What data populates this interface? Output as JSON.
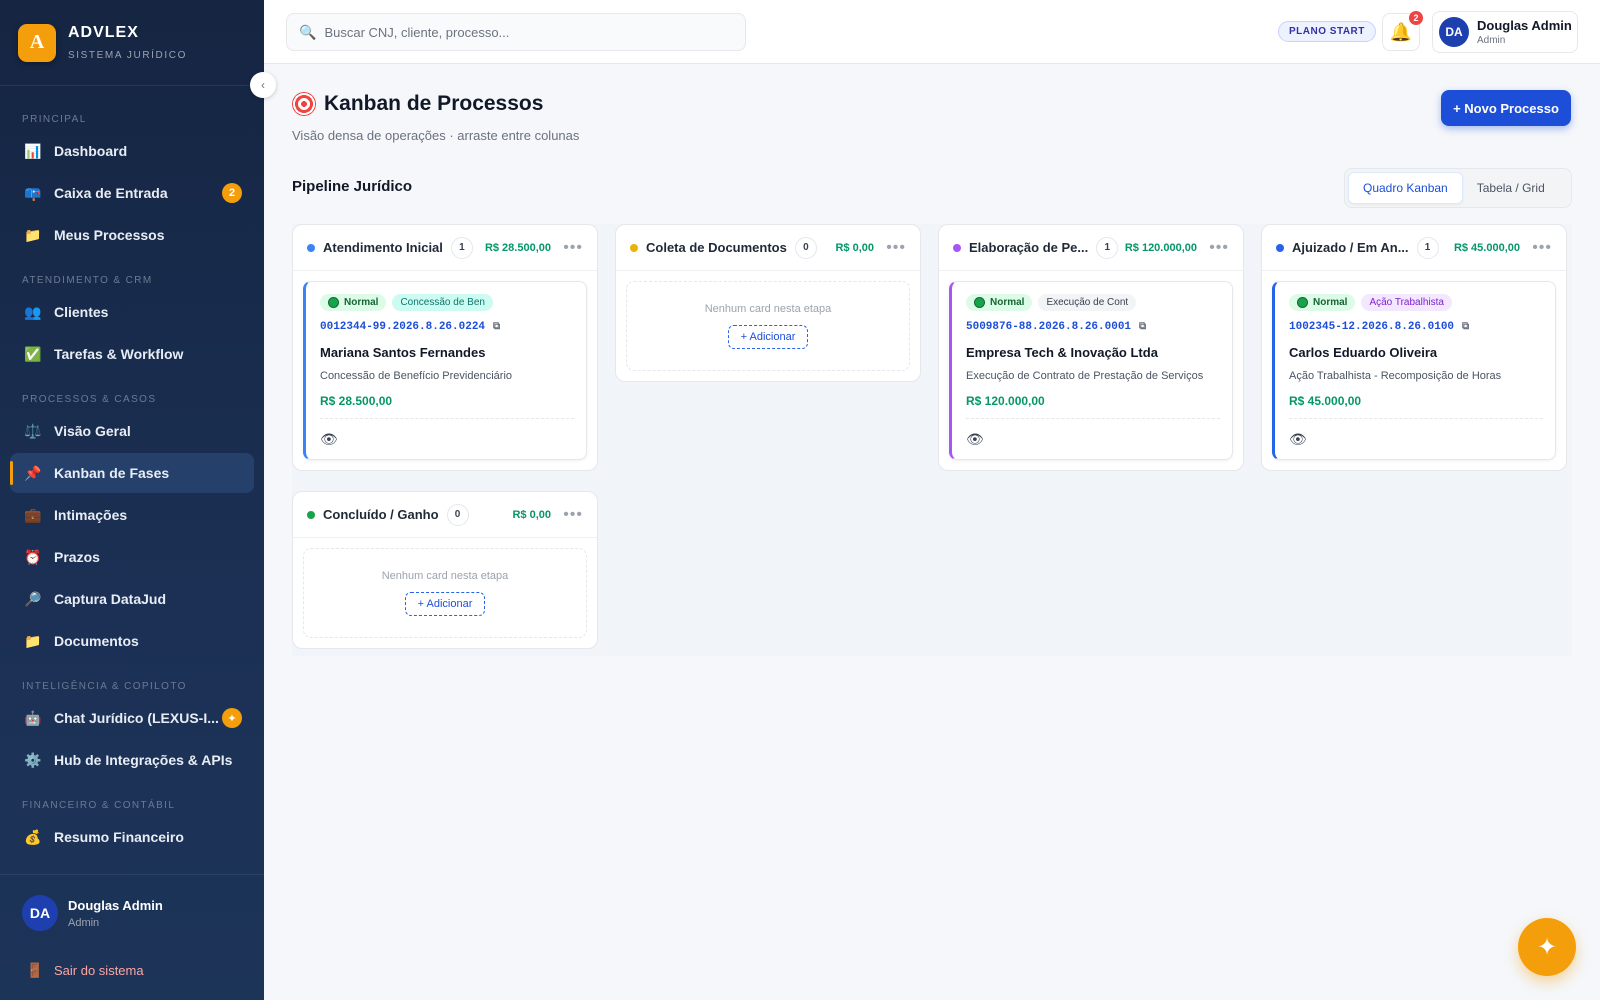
{
  "brand": {
    "logo_letter": "A",
    "name": "ADVLEX",
    "subtitle": "SISTEMA JURÍDICO"
  },
  "sidebar": {
    "sections": [
      {
        "label": "PRINCIPAL"
      },
      {
        "label": "ATENDIMENTO & CRM"
      },
      {
        "label": "PROCESSOS & CASOS"
      },
      {
        "label": "INTELIGÊNCIA & COPILOTO"
      },
      {
        "label": "FINANCEIRO & CONTÁBIL"
      }
    ],
    "items": [
      {
        "label": "Dashboard",
        "icon": "chart-icon"
      },
      {
        "label": "Caixa de Entrada",
        "icon": "mailbox-icon",
        "badge": "2"
      },
      {
        "label": "Meus Processos",
        "icon": "folder-icon"
      },
      {
        "label": "Clientes",
        "icon": "users-icon"
      },
      {
        "label": "Tarefas & Workflow",
        "icon": "check-icon"
      },
      {
        "label": "Visão Geral",
        "icon": "scales-icon"
      },
      {
        "label": "Kanban de Fases",
        "icon": "pin-icon",
        "active": true
      },
      {
        "label": "Intimações",
        "icon": "briefcase-icon"
      },
      {
        "label": "Prazos",
        "icon": "alarm-icon"
      },
      {
        "label": "Captura DataJud",
        "icon": "magnifier-icon"
      },
      {
        "label": "Documentos",
        "icon": "folder-icon"
      },
      {
        "label": "Chat Jurídico (LEXUS-I...",
        "icon": "robot-icon",
        "badge": "✦"
      },
      {
        "label": "Hub de Integrações & APIs",
        "icon": "gear-icon"
      },
      {
        "label": "Resumo Financeiro",
        "icon": "money-bag-icon"
      }
    ],
    "user": {
      "initials": "DA",
      "name": "Douglas Admin",
      "role": "Admin"
    },
    "logout_label": "Sair do sistema"
  },
  "header": {
    "search_placeholder": "Buscar CNJ, cliente, processo...",
    "plan": "PLANO START",
    "notifications": "2",
    "user": {
      "initials": "DA",
      "name": "Douglas Admin",
      "role": "Admin"
    }
  },
  "page": {
    "title": "Kanban de Processos",
    "subtitle": "Visão densa de operações · arraste entre colunas",
    "new_button": "+ Novo Processo",
    "pipeline_title": "Pipeline Jurídico",
    "views": [
      "Quadro Kanban",
      "Tabela / Grid"
    ],
    "active_view": "Quadro Kanban"
  },
  "colors": {
    "accent": "#1d4ed8",
    "brand": "#f59e0b",
    "success": "#059669"
  },
  "columns": [
    {
      "title": "Atendimento Inicial",
      "count": "1",
      "total": "R$ 28.500,00",
      "color": "#3b82f6",
      "cards": [
        {
          "priority": "Normal",
          "type": "Concessão de Ben",
          "type_bg": "#ccfbf1",
          "type_color": "#0f766e",
          "cnj": "0012344-99.2026.8.26.0224",
          "client": "Mariana Santos Fernandes",
          "description": "Concessão de Benefício Previdenciário",
          "value": "R$ 28.500,00",
          "accent": "#3b82f6"
        }
      ]
    },
    {
      "title": "Coleta de Documentos",
      "count": "0",
      "total": "R$ 0,00",
      "color": "#eab308",
      "cards": [],
      "empty_text": "Nenhum card nesta etapa",
      "add_label": "+ Adicionar"
    },
    {
      "title": "Elaboração de Pe...",
      "count": "1",
      "total": "R$ 120.000,00",
      "color": "#a855f7",
      "cards": [
        {
          "priority": "Normal",
          "type": "Execução de Cont",
          "type_bg": "#f3f4f6",
          "type_color": "#374151",
          "cnj": "5009876-88.2026.8.26.0001",
          "client": "Empresa Tech & Inovação Ltda",
          "description": "Execução de Contrato de Prestação de Serviços",
          "value": "R$ 120.000,00",
          "accent": "#a855f7"
        }
      ]
    },
    {
      "title": "Ajuizado / Em An...",
      "count": "1",
      "total": "R$ 45.000,00",
      "color": "#2563eb",
      "cards": [
        {
          "priority": "Normal",
          "type": "Ação Trabalhista",
          "type_bg": "#f3e8ff",
          "type_color": "#7e22ce",
          "cnj": "1002345-12.2026.8.26.0100",
          "client": "Carlos Eduardo Oliveira",
          "description": "Ação Trabalhista - Recomposição de Horas",
          "value": "R$ 45.000,00",
          "accent": "#2563eb"
        }
      ]
    },
    {
      "title": "Concluído / Ganho",
      "count": "0",
      "total": "R$ 0,00",
      "color": "#16a34a",
      "cards": [],
      "empty_text": "Nenhum card nesta etapa",
      "add_label": "+ Adicionar"
    }
  ]
}
